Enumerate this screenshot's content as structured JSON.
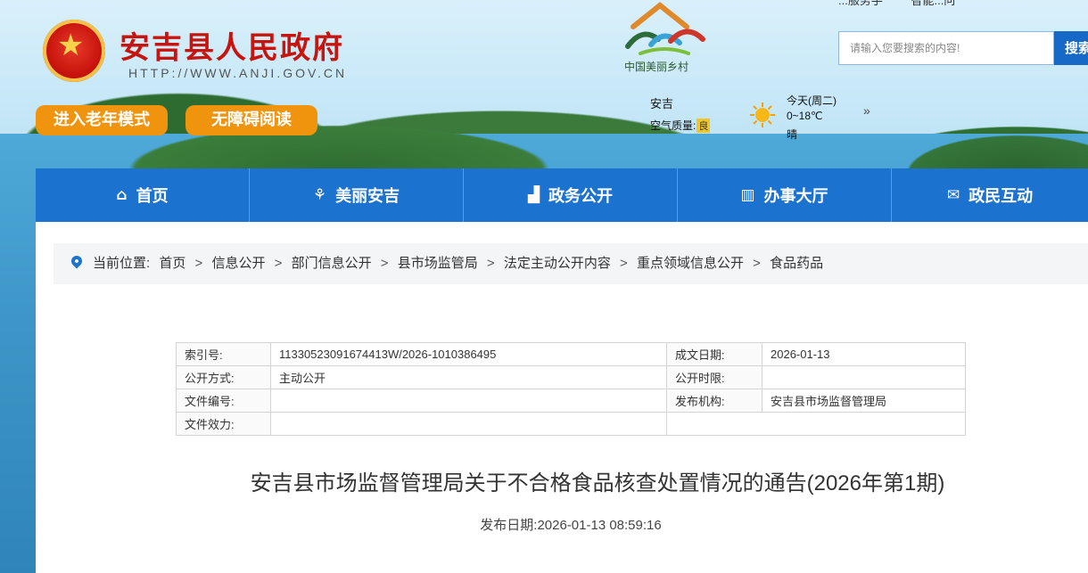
{
  "header": {
    "site_title": "安吉县人民政府",
    "site_url": "HTTP://WWW.ANJI.GOV.CN",
    "elder_mode": "进入老年模式",
    "accessible_reading": "无障碍阅读",
    "village_caption": "中国美丽乡村",
    "top_links": [
      "...服务手",
      "智能...问"
    ],
    "search": {
      "placeholder": "请输入您要搜索的内容!",
      "button": "搜索"
    },
    "weather": {
      "city": "安吉",
      "aqi_label": "空气质量:",
      "aqi_value": "良",
      "day": "今天(周二)",
      "temp": "0~18℃",
      "condition": "晴",
      "more": "»"
    }
  },
  "nav": [
    {
      "label": "首页",
      "icon": "home-icon"
    },
    {
      "label": "美丽安吉",
      "icon": "bamboo-icon"
    },
    {
      "label": "政务公开",
      "icon": "building-icon"
    },
    {
      "label": "办事大厅",
      "icon": "hall-icon"
    },
    {
      "label": "政民互动",
      "icon": "mail-icon"
    }
  ],
  "breadcrumb": {
    "label": "当前位置:",
    "items": [
      "首页",
      "信息公开",
      "部门信息公开",
      "县市场监管局",
      "法定主动公开内容",
      "重点领域信息公开",
      "食品药品"
    ],
    "separator": ">"
  },
  "meta": {
    "index_label": "索引号:",
    "index_value": "11330523091674413W/2026-1010386495",
    "created_label": "成文日期:",
    "created_value": "2026-01-13",
    "method_label": "公开方式:",
    "method_value": "主动公开",
    "term_label": "公开时限:",
    "term_value": "",
    "docno_label": "文件编号:",
    "docno_value": "",
    "issuer_label": "发布机构:",
    "issuer_value": "安吉县市场监督管理局",
    "validity_label": "文件效力:",
    "validity_value": ""
  },
  "article": {
    "title": "安吉县市场监督管理局关于不合格食品核查处置情况的通告(2026年第1期)",
    "date_label": "发布日期:",
    "date_value": "2026-01-13 08:59:16"
  },
  "colors": {
    "nav_blue": "#1c72cf",
    "orange": "#f0930d",
    "title_red": "#c8140e"
  }
}
